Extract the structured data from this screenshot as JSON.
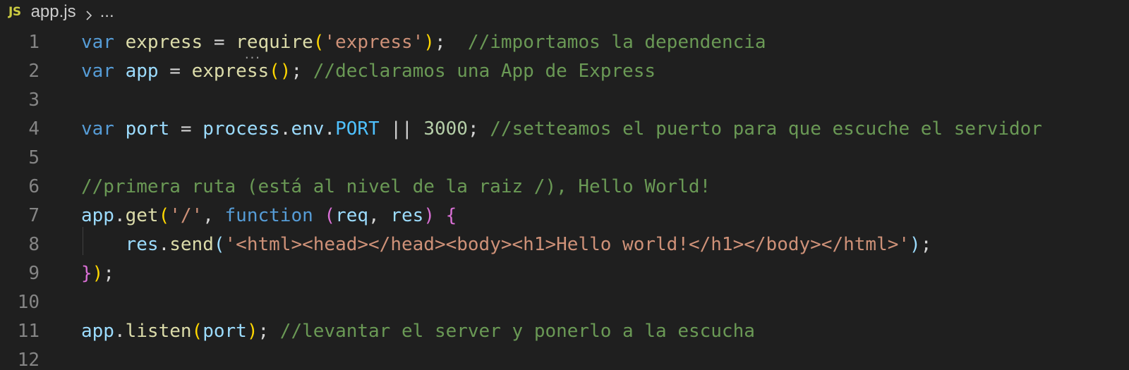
{
  "breadcrumb": {
    "lang_badge": "JS",
    "file_name": "app.js",
    "ellipsis": "..."
  },
  "editor": {
    "line_numbers": [
      "1",
      "2",
      "3",
      "4",
      "5",
      "6",
      "7",
      "8",
      "9",
      "10",
      "11",
      "12"
    ],
    "lines": [
      {
        "tokens": [
          {
            "t": "var",
            "c": "kw"
          },
          {
            "t": " ",
            "c": "op"
          },
          {
            "t": "express",
            "c": "fn"
          },
          {
            "t": " = ",
            "c": "op"
          },
          {
            "t": "require",
            "c": "fn"
          },
          {
            "t": "(",
            "c": "p1"
          },
          {
            "t": "'express'",
            "c": "str"
          },
          {
            "t": ")",
            "c": "p1"
          },
          {
            "t": ";  ",
            "c": "op"
          },
          {
            "t": "//importamos la dependencia",
            "c": "cm"
          }
        ]
      },
      {
        "tokens": [
          {
            "t": "var",
            "c": "kw"
          },
          {
            "t": " ",
            "c": "op"
          },
          {
            "t": "app",
            "c": "var"
          },
          {
            "t": " = ",
            "c": "op"
          },
          {
            "t": "express",
            "c": "fn"
          },
          {
            "t": "()",
            "c": "p1"
          },
          {
            "t": "; ",
            "c": "op"
          },
          {
            "t": "//declaramos una App de Express",
            "c": "cm"
          }
        ]
      },
      {
        "tokens": []
      },
      {
        "tokens": [
          {
            "t": "var",
            "c": "kw"
          },
          {
            "t": " ",
            "c": "op"
          },
          {
            "t": "port",
            "c": "var"
          },
          {
            "t": " = ",
            "c": "op"
          },
          {
            "t": "process",
            "c": "var"
          },
          {
            "t": ".",
            "c": "op"
          },
          {
            "t": "env",
            "c": "var"
          },
          {
            "t": ".",
            "c": "op"
          },
          {
            "t": "PORT",
            "c": "cst"
          },
          {
            "t": " || ",
            "c": "op"
          },
          {
            "t": "3000",
            "c": "num"
          },
          {
            "t": "; ",
            "c": "op"
          },
          {
            "t": "//setteamos el puerto para que escuche el servidor",
            "c": "cm"
          }
        ]
      },
      {
        "tokens": []
      },
      {
        "tokens": [
          {
            "t": "//primera ruta (está al nivel de la raiz /), Hello World!",
            "c": "cm"
          }
        ]
      },
      {
        "tokens": [
          {
            "t": "app",
            "c": "var"
          },
          {
            "t": ".",
            "c": "op"
          },
          {
            "t": "get",
            "c": "fn"
          },
          {
            "t": "(",
            "c": "p1"
          },
          {
            "t": "'/'",
            "c": "str"
          },
          {
            "t": ", ",
            "c": "op"
          },
          {
            "t": "function",
            "c": "kw"
          },
          {
            "t": " ",
            "c": "op"
          },
          {
            "t": "(",
            "c": "p2"
          },
          {
            "t": "req",
            "c": "var"
          },
          {
            "t": ", ",
            "c": "op"
          },
          {
            "t": "res",
            "c": "var"
          },
          {
            "t": ")",
            "c": "p2"
          },
          {
            "t": " ",
            "c": "op"
          },
          {
            "t": "{",
            "c": "p2"
          }
        ]
      },
      {
        "tokens": [
          {
            "t": "    ",
            "c": "op"
          },
          {
            "t": "res",
            "c": "var"
          },
          {
            "t": ".",
            "c": "op"
          },
          {
            "t": "send",
            "c": "fn"
          },
          {
            "t": "(",
            "c": "var"
          },
          {
            "t": "'<html><head></head><body><h1>Hello world!</h1></body></html>'",
            "c": "str"
          },
          {
            "t": ")",
            "c": "var"
          },
          {
            "t": ";",
            "c": "op"
          }
        ]
      },
      {
        "tokens": [
          {
            "t": "}",
            "c": "p2"
          },
          {
            "t": ")",
            "c": "p1"
          },
          {
            "t": ";",
            "c": "op"
          }
        ]
      },
      {
        "tokens": []
      },
      {
        "tokens": [
          {
            "t": "app",
            "c": "var"
          },
          {
            "t": ".",
            "c": "op"
          },
          {
            "t": "listen",
            "c": "fn"
          },
          {
            "t": "(",
            "c": "p1"
          },
          {
            "t": "port",
            "c": "var"
          },
          {
            "t": ")",
            "c": "p1"
          },
          {
            "t": "; ",
            "c": "op"
          },
          {
            "t": "//levantar el server y ponerlo a la escucha",
            "c": "cm"
          }
        ]
      },
      {
        "tokens": []
      }
    ]
  },
  "hint_marker": "...",
  "colors": {
    "background": "#1f1f1f",
    "keyword": "#569cd6",
    "variable": "#9cdcfe",
    "function": "#dcdcaa",
    "string": "#ce9178",
    "comment": "#6a9955",
    "number": "#b5cea8",
    "constant": "#4fc1ff",
    "bracket_level1": "#ffd700",
    "bracket_level2": "#da70d6",
    "line_number": "#858585",
    "js_badge": "#cbcb41"
  },
  "icons": {
    "file_type": "javascript-file-icon",
    "separator": "chevron-right-icon"
  }
}
